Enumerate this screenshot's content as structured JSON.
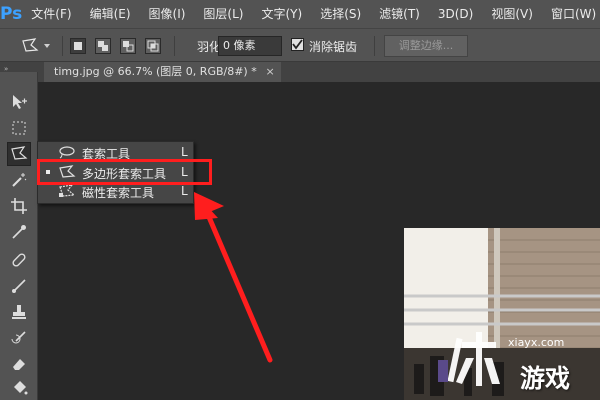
{
  "app": {
    "logo": "Ps",
    "menu": [
      "文件(F)",
      "编辑(E)",
      "图像(I)",
      "图层(L)",
      "文字(Y)",
      "选择(S)",
      "滤镜(T)",
      "3D(D)",
      "视图(V)",
      "窗口(W)"
    ]
  },
  "options": {
    "tool_preset_icon": "polygonal-lasso-icon",
    "selection_modes": [
      "new-selection",
      "add-to-selection",
      "subtract-from-selection",
      "intersect-with-selection"
    ],
    "feather_label": "羽化:",
    "feather_value": "0 像素",
    "antialias_label": "消除锯齿",
    "antialias_checked": true,
    "refine_edge_label": "调整边缘..."
  },
  "document": {
    "tab_title": "timg.jpg @ 66.7% (图层 0, RGB/8#) *",
    "tab_close": "×"
  },
  "flyout": {
    "items": [
      {
        "label": "套索工具",
        "shortcut": "L",
        "icon": "lasso-icon",
        "selected": false
      },
      {
        "label": "多边形套索工具",
        "shortcut": "L",
        "icon": "polygonal-lasso-icon",
        "selected": true
      },
      {
        "label": "磁性套索工具",
        "shortcut": "L",
        "icon": "magnetic-lasso-icon",
        "selected": false
      }
    ]
  },
  "tools": [
    "move-tool-icon",
    "marquee-tool-icon",
    "lasso-tool-icon",
    "magic-wand-icon",
    "crop-tool-icon",
    "eyedropper-icon",
    "healing-brush-icon",
    "brush-tool-icon",
    "clone-stamp-icon",
    "history-brush-icon",
    "eraser-icon",
    "paint-bucket-icon"
  ],
  "watermark": {
    "url": "xiayx.com",
    "brand": "游戏"
  },
  "colors": {
    "annotation": "#ff1e1e",
    "logo": "#3ca1ff"
  }
}
